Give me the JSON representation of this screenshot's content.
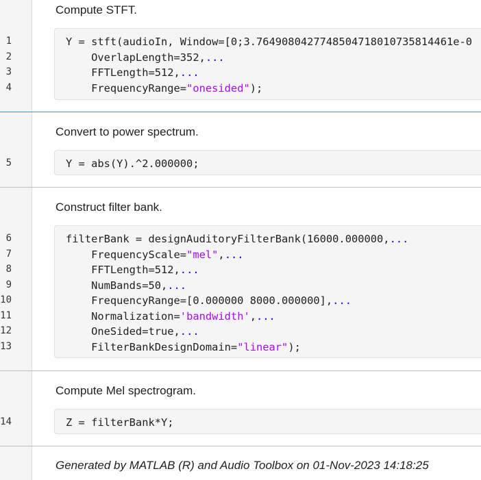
{
  "sections": [
    {
      "text": "Compute STFT.",
      "line_numbers": [
        "1",
        "2",
        "3",
        "4"
      ],
      "code": [
        {
          "pre": "Y = stft(audioIn, Window=[0;3.7649080427748504718010735814461e-0",
          "str": "",
          "post": "",
          "cont": ""
        },
        {
          "pre": "    OverlapLength=352,",
          "str": "",
          "post": "",
          "cont": "..."
        },
        {
          "pre": "    FFTLength=512,",
          "str": "",
          "post": "",
          "cont": "..."
        },
        {
          "pre": "    FrequencyRange=",
          "str": "\"onesided\"",
          "post": ");",
          "cont": ""
        }
      ]
    },
    {
      "text": "Convert to power spectrum.",
      "line_numbers": [
        "5"
      ],
      "code": [
        {
          "pre": "Y = abs(Y).^2.000000;",
          "str": "",
          "post": "",
          "cont": ""
        }
      ]
    },
    {
      "text": "Construct filter bank.",
      "line_numbers": [
        "6",
        "7",
        "8",
        "9",
        "10",
        "11",
        "12",
        "13"
      ],
      "code": [
        {
          "pre": "filterBank = designAuditoryFilterBank(16000.000000,",
          "str": "",
          "post": "",
          "cont": "..."
        },
        {
          "pre": "    FrequencyScale=",
          "str": "\"mel\"",
          "post": ",",
          "cont": "..."
        },
        {
          "pre": "    FFTLength=512,",
          "str": "",
          "post": "",
          "cont": "..."
        },
        {
          "pre": "    NumBands=50,",
          "str": "",
          "post": "",
          "cont": "..."
        },
        {
          "pre": "    FrequencyRange=[0.000000 8000.000000],",
          "str": "",
          "post": "",
          "cont": "..."
        },
        {
          "pre": "    Normalization=",
          "str": "'bandwidth'",
          "post": ",",
          "cont": "..."
        },
        {
          "pre": "    OneSided=true,",
          "str": "",
          "post": "",
          "cont": "..."
        },
        {
          "pre": "    FilterBankDesignDomain=",
          "str": "\"linear\"",
          "post": ");",
          "cont": ""
        }
      ]
    },
    {
      "text": "Compute Mel spectrogram.",
      "line_numbers": [
        "14"
      ],
      "code": [
        {
          "pre": "Z = filterBank*Y;",
          "str": "",
          "post": "",
          "cont": ""
        }
      ]
    }
  ],
  "footer": {
    "text": "Generated by MATLAB (R) and Audio Toolbox on 01-Nov-2023 14:18:25"
  },
  "colors": {
    "string": "#a709f5",
    "continuation": "#0e00ff",
    "active_divider": "#4a8fd4"
  }
}
